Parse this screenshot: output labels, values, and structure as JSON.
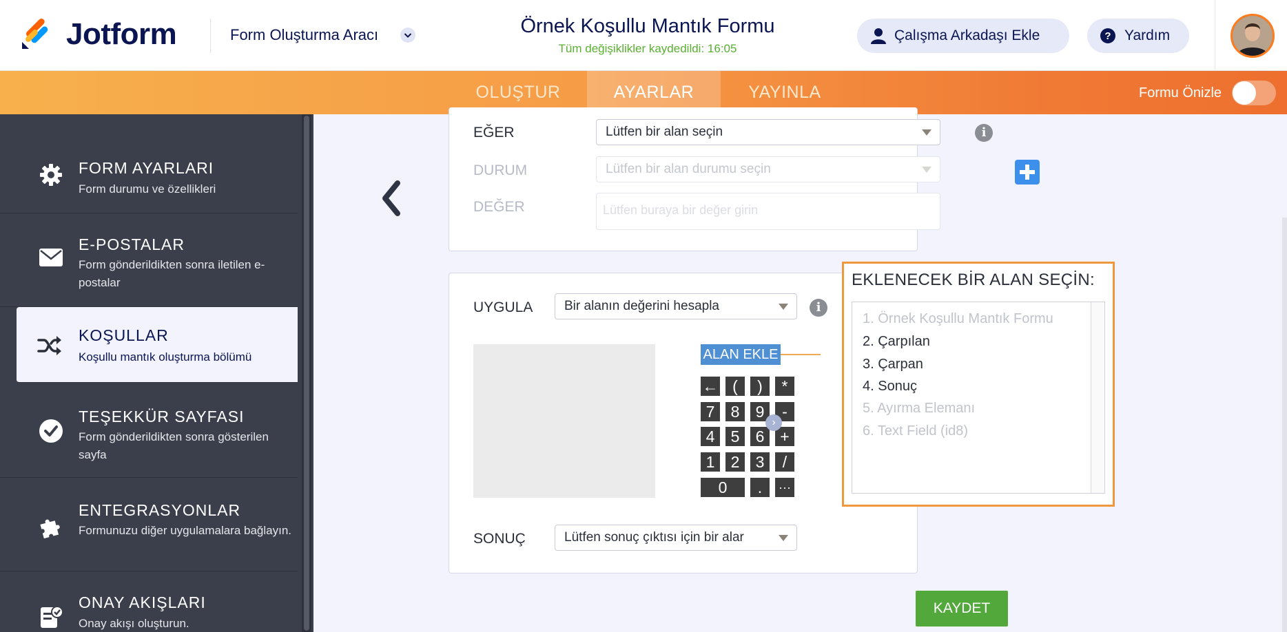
{
  "header": {
    "brand": "Jotform",
    "builder_label": "Form Oluşturma Aracı",
    "form_title": "Örnek Koşullu Mantık Formu",
    "save_status": "Tüm değişiklikler kaydedildi: 16:05",
    "add_collaborator_label": "Çalışma Arkadaşı Ekle",
    "help_label": "Yardım",
    "colors": {
      "brand": "#0a1551",
      "saved": "#59b031",
      "accent": "#ff7b1c"
    }
  },
  "tabs": [
    {
      "label": "OLUŞTUR",
      "active": false
    },
    {
      "label": "AYARLAR",
      "active": true
    },
    {
      "label": "YAYINLA",
      "active": false
    }
  ],
  "preview": {
    "label": "Formu Önizle",
    "enabled": false
  },
  "sidebar": {
    "items": [
      {
        "title": "FORM AYARLARI",
        "desc": "Form durumu ve özellikleri",
        "icon": "gear-icon"
      },
      {
        "title": "E-POSTALAR",
        "desc": "Form gönderildikten sonra iletilen e-postalar",
        "icon": "envelope-icon"
      },
      {
        "title": "KOŞULLAR",
        "desc": "Koşullu mantık oluşturma bölümü",
        "icon": "shuffle-icon",
        "active": true
      },
      {
        "title": "TEŞEKKÜR SAYFASI",
        "desc": "Form gönderildikten sonra gösterilen sayfa",
        "icon": "check-circle-icon"
      },
      {
        "title": "ENTEGRASYONLAR",
        "desc": "Formunuzu diğer uygulamalara bağlayın.",
        "icon": "puzzle-icon"
      },
      {
        "title": "ONAY AKIŞLARI",
        "desc": "Onay akışı oluşturun.",
        "icon": "approval-icon"
      }
    ]
  },
  "condition": {
    "if_label": "EĞER",
    "if_value": "Lütfen bir alan seçin",
    "state_label": "DURUM",
    "state_value": "Lütfen bir alan durumu seçin",
    "value_label": "DEĞER",
    "value_placeholder": "Lütfen buraya bir değer girin"
  },
  "action": {
    "apply_label": "UYGULA",
    "apply_value": "Bir alanın değerini hesapla",
    "add_field_button": "ALAN EKLE",
    "result_label": "SONUÇ",
    "result_value": "Lütfen sonuç çıktısı için bir alar"
  },
  "keypad": {
    "rows": [
      [
        "←",
        "(",
        ")",
        "*"
      ],
      [
        "7",
        "8",
        "9",
        "-"
      ],
      [
        "4",
        "5",
        "6",
        "+"
      ],
      [
        "1",
        "2",
        "3",
        "/"
      ],
      [
        "0",
        ".",
        "···"
      ]
    ]
  },
  "field_picker": {
    "title": "EKLENECEK BİR ALAN SEÇİN:",
    "options": [
      {
        "label": "1. Örnek Koşullu Mantık Formu",
        "enabled": false
      },
      {
        "label": "2. Çarpılan",
        "enabled": true
      },
      {
        "label": "3. Çarpan",
        "enabled": true
      },
      {
        "label": "4. Sonuç",
        "enabled": true
      },
      {
        "label": "5. Ayırma Elemanı",
        "enabled": false
      },
      {
        "label": "6. Text Field (id8)",
        "enabled": false
      }
    ]
  },
  "save_button": "KAYDET"
}
